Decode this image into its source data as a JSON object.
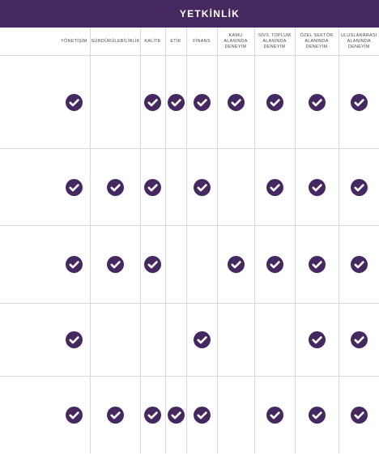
{
  "banner": {
    "title": "YETKİNLİK"
  },
  "columns": [
    {
      "label": "YÖNETİŞİM"
    },
    {
      "label": "SÜRDÜRÜLEBİLİRLİK"
    },
    {
      "label": "KALİTE"
    },
    {
      "label": "ETİK"
    },
    {
      "label": "FİNANS"
    },
    {
      "label": "KAMU ALANINDA DENEYİM"
    },
    {
      "label": "SİVİL TOPLUM ALANINDA DENEYİM"
    },
    {
      "label": "ÖZEL SEKTÖR ALANINDA DENEYİM"
    },
    {
      "label": "ULUSLARARASI ALANINDA DENEYİM"
    }
  ],
  "icons": {
    "check": "check-circle-icon"
  },
  "colors": {
    "accent": "#45285f",
    "check": "#45285f",
    "border": "#d9d9d9"
  },
  "rows": [
    {
      "checks": [
        1,
        0,
        1,
        1,
        1,
        1,
        1,
        1,
        1
      ]
    },
    {
      "checks": [
        1,
        1,
        1,
        0,
        1,
        0,
        1,
        1,
        1
      ]
    },
    {
      "checks": [
        1,
        1,
        1,
        0,
        0,
        1,
        1,
        1,
        1
      ]
    },
    {
      "checks": [
        1,
        0,
        0,
        0,
        1,
        0,
        0,
        1,
        1
      ]
    },
    {
      "checks": [
        1,
        1,
        1,
        1,
        1,
        0,
        1,
        1,
        1
      ]
    }
  ]
}
